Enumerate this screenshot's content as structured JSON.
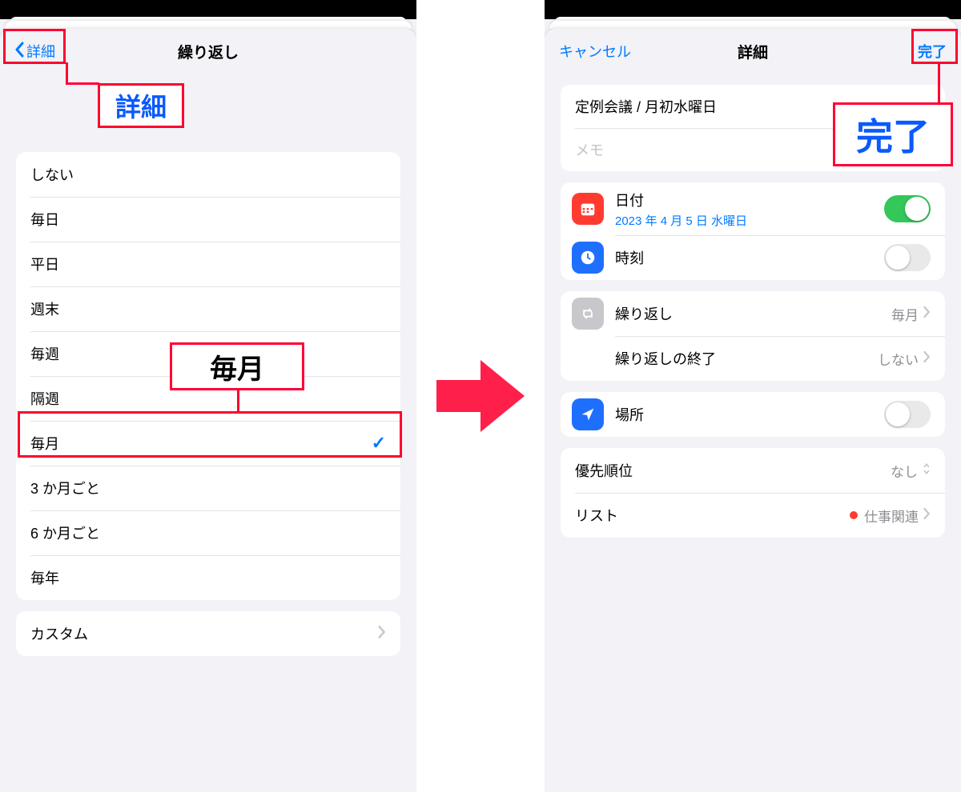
{
  "left": {
    "back_label": "詳細",
    "title": "繰り返し",
    "options": {
      "none": "しない",
      "daily": "毎日",
      "weekdays": "平日",
      "weekends": "週末",
      "weekly": "毎週",
      "biweekly": "隔週",
      "monthly": "毎月",
      "every3months": "3 か月ごと",
      "every6months": "6 か月ごと",
      "yearly": "毎年"
    },
    "selected": "毎月",
    "custom": "カスタム",
    "callout_back": "詳細",
    "callout_monthly": "毎月"
  },
  "right": {
    "cancel": "キャンセル",
    "title": "詳細",
    "done": "完了",
    "task_title": "定例会議 / 月初水曜日",
    "memo_placeholder": "メモ",
    "date_label": "日付",
    "date_value": "2023 年 4 月 5 日 水曜日",
    "time_label": "時刻",
    "repeat_label": "繰り返し",
    "repeat_value": "毎月",
    "repeat_end_label": "繰り返しの終了",
    "repeat_end_value": "しない",
    "location_label": "場所",
    "priority_label": "優先順位",
    "priority_value": "なし",
    "list_label": "リスト",
    "list_value": "仕事関連",
    "callout_done": "完了"
  }
}
